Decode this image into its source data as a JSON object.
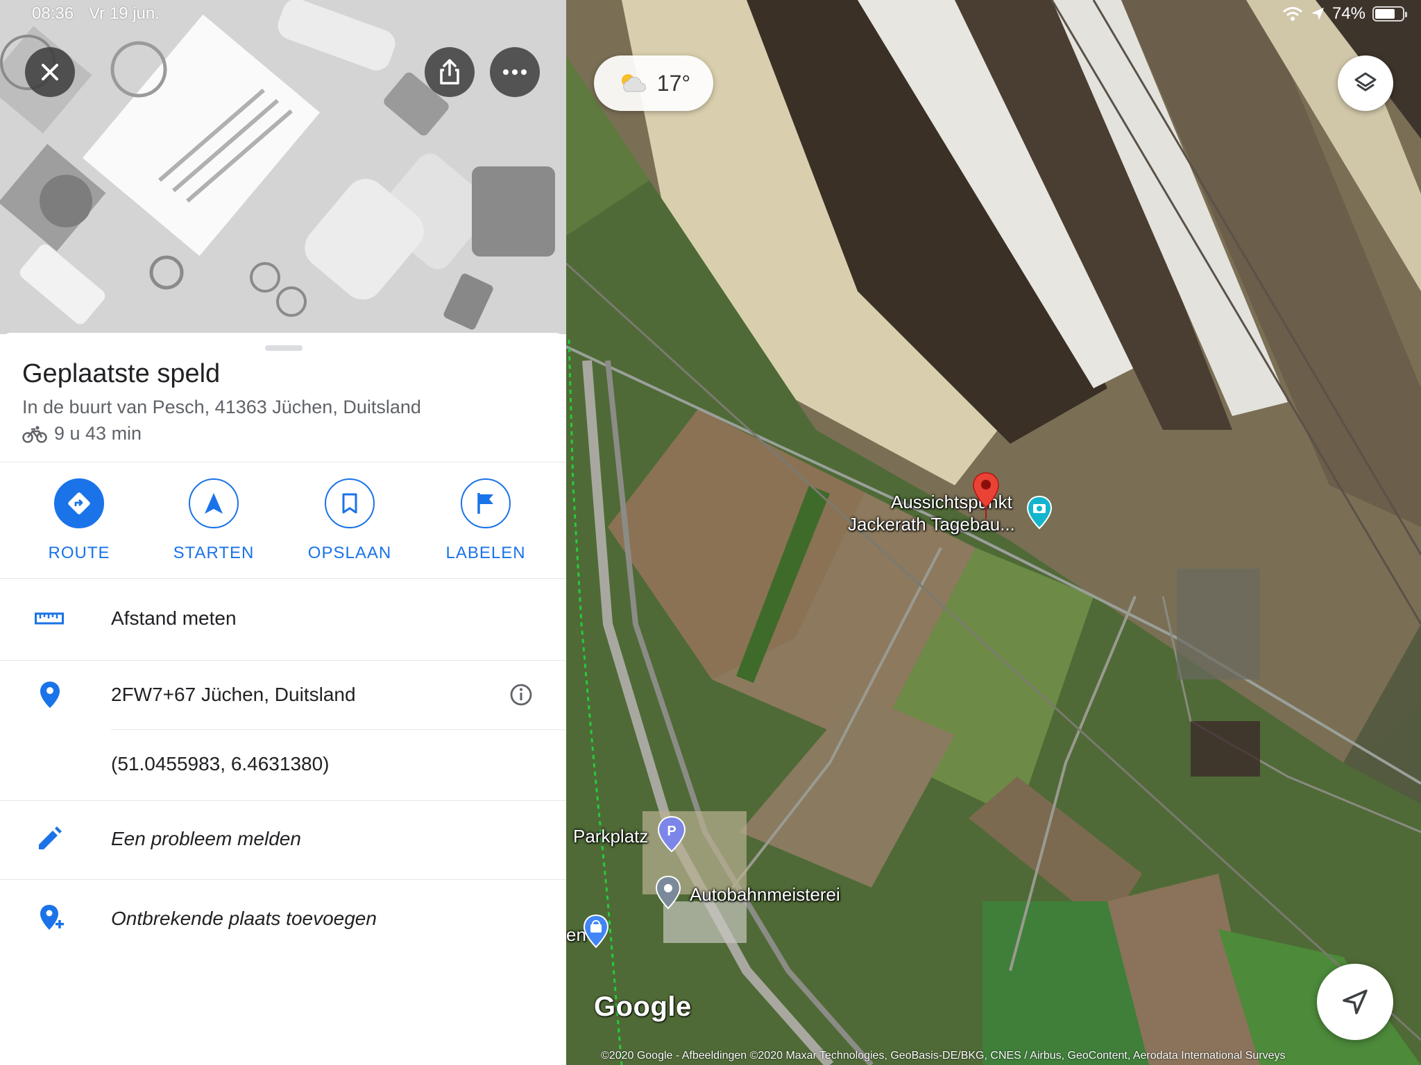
{
  "status_bar": {
    "time": "08:36",
    "date": "Vr 19 jun.",
    "battery": "74%",
    "battery_level": 0.74
  },
  "place": {
    "title": "Geplaatste speld",
    "address": "In de buurt van Pesch, 41363 Jüchen, Duitsland",
    "travel_time": "9 u 43 min"
  },
  "actions": [
    {
      "label": "ROUTE",
      "icon": "directions-icon"
    },
    {
      "label": "STARTEN",
      "icon": "navigation-arrow-icon"
    },
    {
      "label": "OPSLAAN",
      "icon": "bookmark-icon"
    },
    {
      "label": "LABELEN",
      "icon": "flag-icon"
    }
  ],
  "details": {
    "measure_distance": "Afstand meten",
    "plus_code": "2FW7+67 Jüchen, Duitsland",
    "coordinates": "(51.0455983, 6.4631380)",
    "report_problem": "Een probleem melden",
    "add_missing_place": "Ontbrekende plaats toevoegen"
  },
  "map": {
    "temperature": "17°",
    "poi_viewpoint_line1": "Aussichtspunkt",
    "poi_viewpoint_line2": "Jackerath Tagebau...",
    "poi_parking": "Parkplatz",
    "poi_autobahn": "Autobahnmeisterei",
    "poi_partial": "en",
    "logo": "Google",
    "copyright": "©2020 Google - Afbeeldingen ©2020 Maxar Technologies, GeoBasis-DE/BKG, CNES / Airbus, GeoContent, Aerodata International Surveys"
  },
  "colors": {
    "accent": "#1a73e8",
    "pin": "#ea4335",
    "camera_poi": "#12b5cb",
    "parking_poi": "#7b86e8"
  }
}
